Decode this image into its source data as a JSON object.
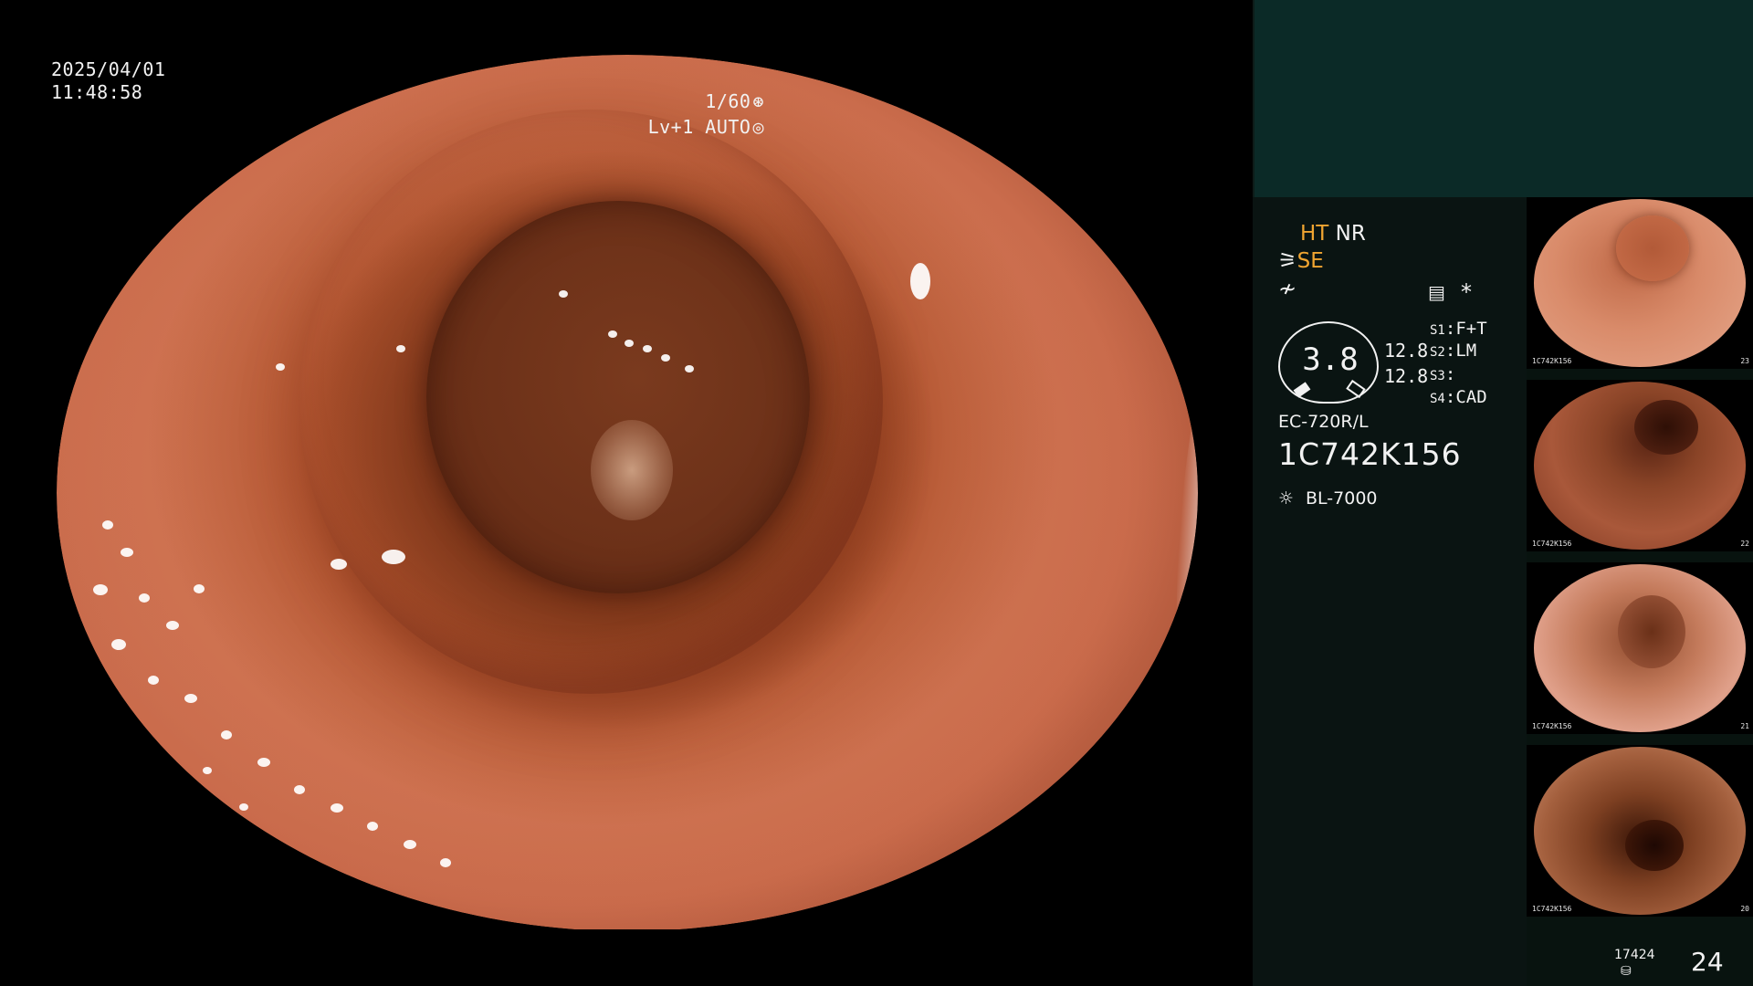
{
  "overlay": {
    "date": "2025/04/01",
    "time": "11:48:58",
    "shutter": "1/60",
    "shutter_icon": "shutter-icon",
    "level": "Lv+1 AUTO",
    "level_icon": "iris-icon"
  },
  "status": {
    "ht": "HT",
    "nr": "NR",
    "se": "SE",
    "menu_icon": "menu-list-icon",
    "star": "*"
  },
  "dial": {
    "value": "3.8",
    "side_value_1": "12.8",
    "side_value_2": "12.8"
  },
  "switches": [
    {
      "key": "S1",
      "value": "F+T"
    },
    {
      "key": "S2",
      "value": "LM"
    },
    {
      "key": "S3",
      "value": ""
    },
    {
      "key": "S4",
      "value": "CAD"
    }
  ],
  "scope": {
    "model": "EC-720R/L",
    "serial": "1C742K156"
  },
  "light_source": {
    "icon": "lamp-icon",
    "model": "BL-7000"
  },
  "thumbnails": [
    {
      "label_1": "1C742K156",
      "num": "23"
    },
    {
      "label_1": "1C742K156",
      "num": "22"
    },
    {
      "label_1": "1C742K156",
      "num": "21"
    },
    {
      "label_1": "1C742K156",
      "num": "20"
    }
  ],
  "storage": {
    "count": "17424",
    "icon": "storage-disk-icon",
    "images": "24"
  },
  "colors": {
    "status_yellow": "#f0a531",
    "panel_top": "#0b2a27",
    "panel_bg": "#0a1412"
  }
}
